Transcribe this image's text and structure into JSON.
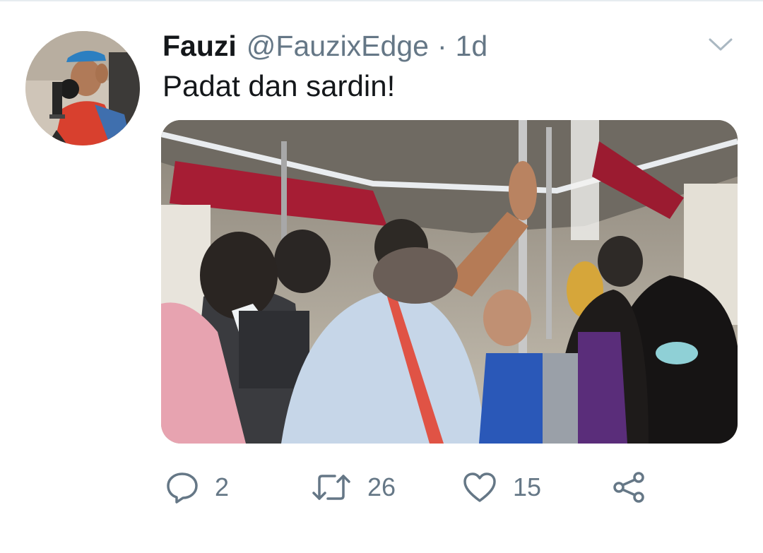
{
  "author": {
    "display_name": "Fauzi",
    "handle": "@FauzixEdge",
    "separator": "·",
    "timestamp": "1d"
  },
  "tweet": {
    "text": "Padat dan sardin!"
  },
  "actions": {
    "reply_count": "2",
    "retweet_count": "26",
    "like_count": "15"
  },
  "colors": {
    "text_primary": "#14171a",
    "text_secondary": "#657786",
    "icon": "#657786",
    "caret": "#aab8c2"
  },
  "icons": {
    "reply": "reply-icon",
    "retweet": "retweet-icon",
    "like": "heart-icon",
    "share": "share-icon",
    "menu": "chevron-down-icon"
  }
}
